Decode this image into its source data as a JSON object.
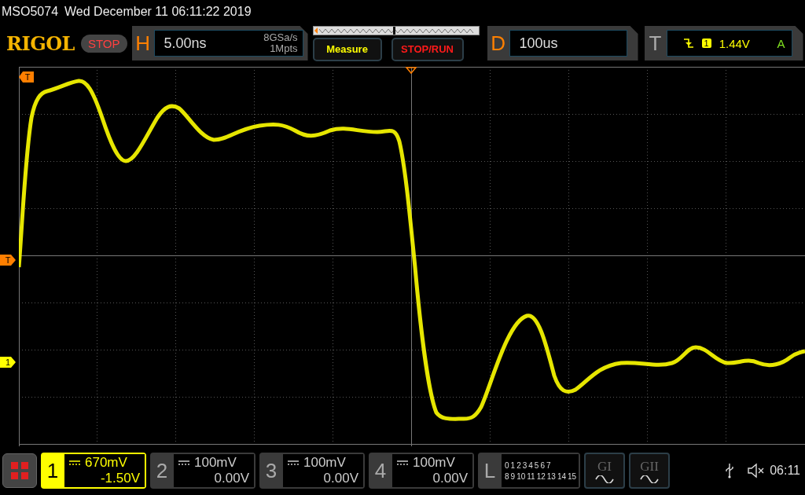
{
  "status_line": {
    "model": "MSO5074",
    "datetime": "Wed December 11 06:11:22 2019"
  },
  "logo": "RIGOL",
  "run_state": "STOP",
  "horizontal": {
    "label": "H",
    "timebase": "5.00ns",
    "sample_rate": "8GSa/s",
    "memory_depth": "1Mpts"
  },
  "buttons": [
    {
      "label": "Measure",
      "kind": "menu"
    },
    {
      "label": "STOP/RUN",
      "kind": "action"
    }
  ],
  "delay": {
    "label": "D",
    "value": "100us"
  },
  "trigger": {
    "label": "T",
    "source": "1",
    "level": "1.44V",
    "mode": "A"
  },
  "markers": [
    {
      "label": "T",
      "color": "#ff7f00"
    },
    {
      "label": "T",
      "color": "#ff7f00"
    },
    {
      "label": "1",
      "color": "#ffff00"
    }
  ],
  "channels": [
    {
      "label": "1",
      "scale": "670mV",
      "offset": "-1.50V",
      "selected": true
    },
    {
      "label": "2",
      "scale": "100mV",
      "offset": "0.00V",
      "selected": false
    },
    {
      "label": "3",
      "scale": "100mV",
      "offset": "0.00V",
      "selected": false
    },
    {
      "label": "4",
      "scale": "100mV",
      "offset": "0.00V",
      "selected": false
    }
  ],
  "logic": {
    "label": "L",
    "bits": [
      [
        "0",
        "1",
        "2",
        "3",
        "4",
        "5",
        "6",
        "7"
      ],
      [
        "8",
        "9",
        "10",
        "11",
        "12",
        "13",
        "14",
        "15"
      ]
    ]
  },
  "generators": [
    "GI",
    "GII"
  ],
  "clock": "06:11"
}
